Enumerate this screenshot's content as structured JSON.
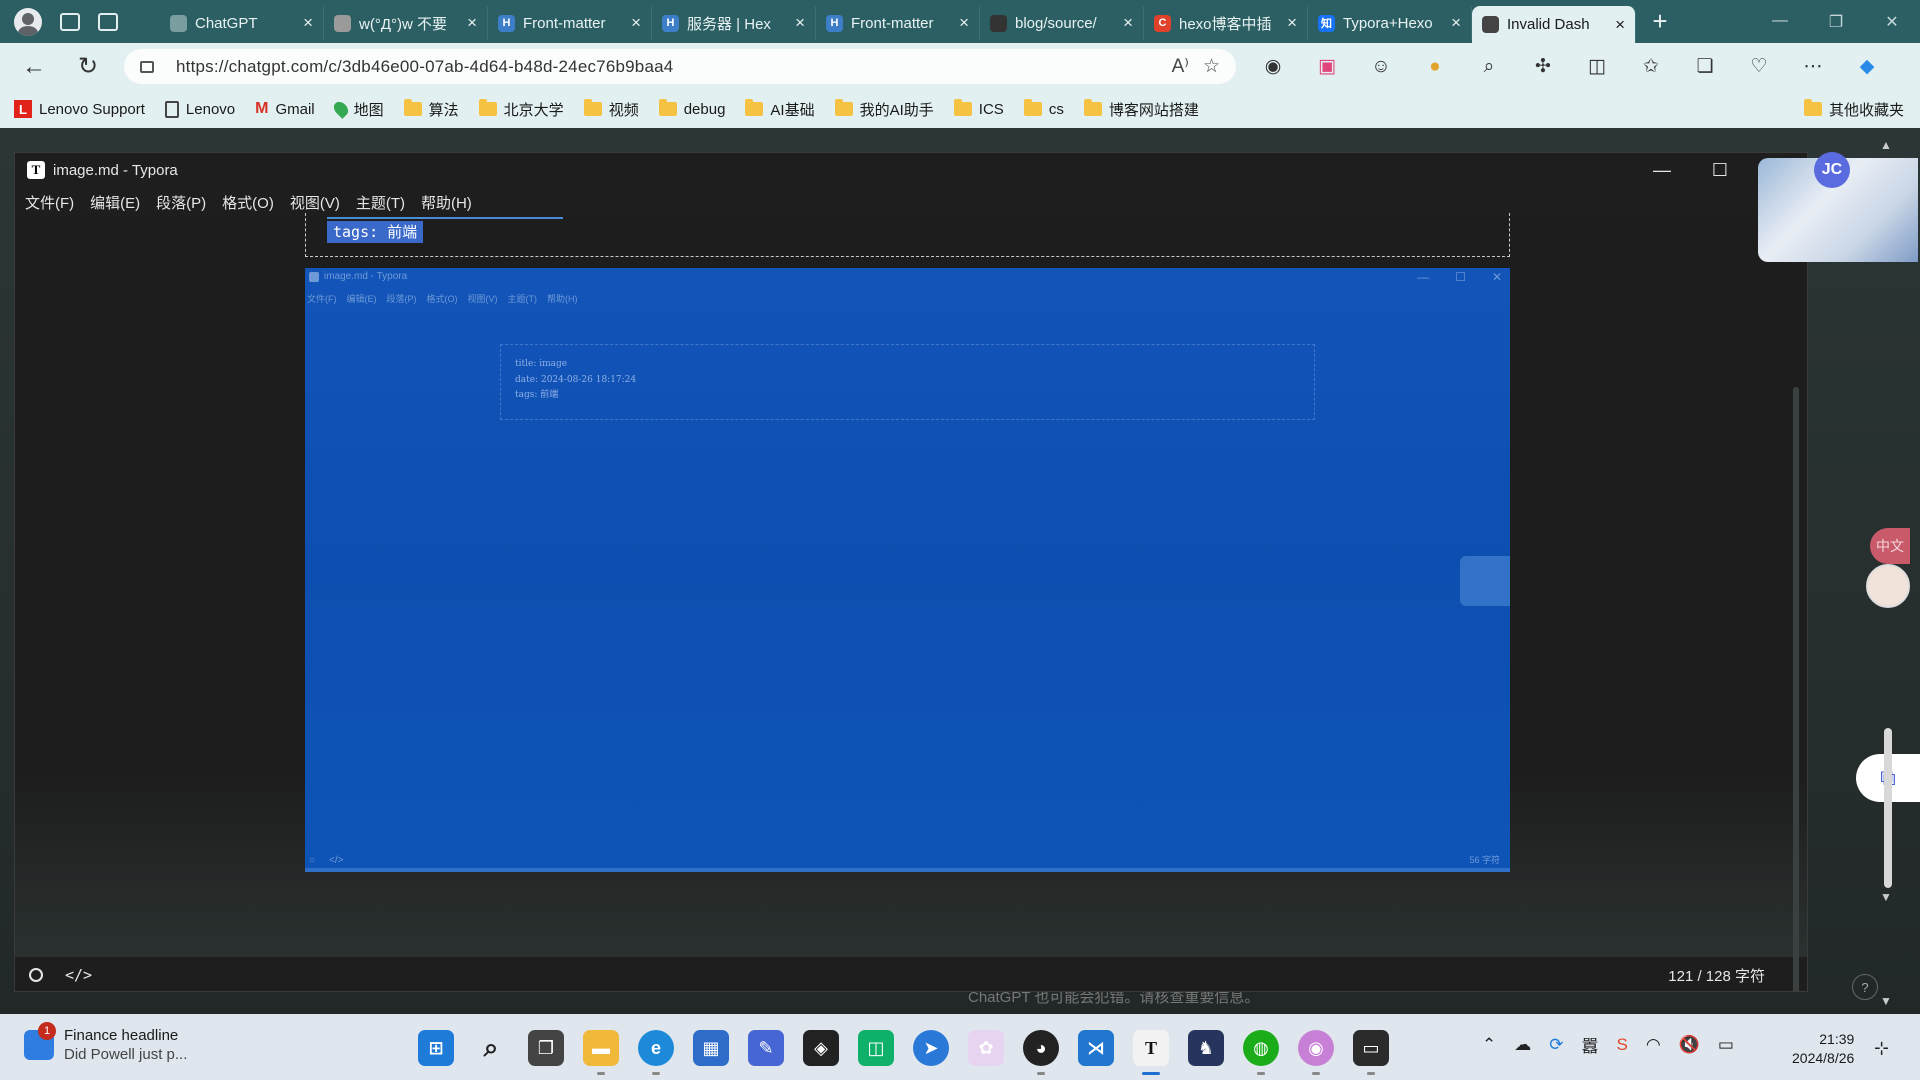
{
  "browser": {
    "tabs": [
      {
        "label": "ChatGPT",
        "icon": "chatgpt-icon",
        "color": "#7a9e9f"
      },
      {
        "label": "w(°Д°)w 不要",
        "icon": "emoji-icon",
        "color": "#9a9a9a"
      },
      {
        "label": "Front-matter",
        "icon": "hexo-icon",
        "color": "#3d7ec9"
      },
      {
        "label": "服务器 | Hex",
        "icon": "hexo-icon",
        "color": "#3d7ec9"
      },
      {
        "label": "Front-matter",
        "icon": "hexo-icon",
        "color": "#3d7ec9"
      },
      {
        "label": "blog/source/",
        "icon": "github-icon",
        "color": "#333333"
      },
      {
        "label": "hexo博客中插",
        "icon": "csdn-icon",
        "color": "#e0412b"
      },
      {
        "label": "Typora+Hexo",
        "icon": "zhihu-icon",
        "color": "#1772f6"
      },
      {
        "label": "Invalid Dash",
        "icon": "chatgpt-icon",
        "color": "#444444"
      }
    ],
    "fav_text": [
      "",
      "",
      "H",
      "H",
      "H",
      "",
      "C",
      "知",
      ""
    ],
    "url": "https://chatgpt.com/c/3db46e00-07ab-4d64-b48d-24ec76b9baa4",
    "bookmarks": [
      {
        "label": "Lenovo Support",
        "icon": "lenovo-icon"
      },
      {
        "label": "Lenovo",
        "icon": "page-icon"
      },
      {
        "label": "Gmail",
        "icon": "gmail-icon"
      },
      {
        "label": "地图",
        "icon": "map-icon"
      },
      {
        "label": "算法",
        "icon": "folder-icon"
      },
      {
        "label": "北京大学",
        "icon": "folder-icon"
      },
      {
        "label": "视频",
        "icon": "folder-icon"
      },
      {
        "label": "debug",
        "icon": "folder-icon"
      },
      {
        "label": "AI基础",
        "icon": "folder-icon"
      },
      {
        "label": "我的AI助手",
        "icon": "folder-icon"
      },
      {
        "label": "ICS",
        "icon": "folder-icon"
      },
      {
        "label": "cs",
        "icon": "folder-icon"
      },
      {
        "label": "博客网站搭建",
        "icon": "folder-icon"
      }
    ],
    "other_bookmarks": "其他收藏夹",
    "accent": "#2b5f63"
  },
  "typora": {
    "title": "image.md - Typora",
    "menu": [
      "文件(F)",
      "编辑(E)",
      "段落(P)",
      "格式(O)",
      "视图(V)",
      "主题(T)",
      "帮助(H)"
    ],
    "selected_line": "tags: 前端",
    "status_count": "121 / 128 字符",
    "embedded": {
      "title": "image.md - Typora",
      "menu": [
        "文件(F)",
        "编辑(E)",
        "段落(P)",
        "格式(O)",
        "视图(V)",
        "主题(T)",
        "帮助(H)"
      ],
      "frontmatter": [
        "title: image",
        "date: 2024-08-26 18:17:24",
        "tags: 前端"
      ],
      "count": "56 字符"
    }
  },
  "page": {
    "disclaimer": "ChatGPT 也可能会犯错。请核查重要信息。",
    "avatar_initials": "JC",
    "help": "?",
    "zh_badge": "中文"
  },
  "taskbar": {
    "news_title": "Finance headline",
    "news_sub": "Did Powell just p...",
    "news_badge": "1",
    "time": "21:39",
    "date": "2024/8/26"
  }
}
